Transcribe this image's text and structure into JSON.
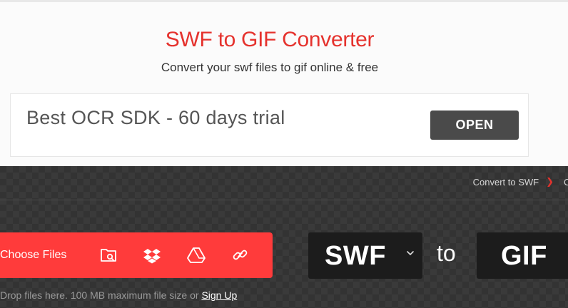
{
  "header": {
    "title": "SWF to GIF Converter",
    "subtitle": "Convert your swf files to gif online & free"
  },
  "ad": {
    "text": "Best OCR SDK - 60 days trial",
    "button_label": "OPEN"
  },
  "breadcrumb": {
    "link": "Convert to SWF",
    "next_partial": "C"
  },
  "upload": {
    "choose_label": "Choose Files",
    "icons": [
      "folder-search-icon",
      "dropbox-icon",
      "google-drive-icon",
      "link-icon"
    ],
    "drop_text": "Drop files here. 100 MB maximum file size or ",
    "signup_label": "Sign Up"
  },
  "converter": {
    "from_format": "SWF",
    "to_word": "to",
    "to_format": "GIF"
  },
  "colors": {
    "accent": "#e5322d",
    "button_red": "#ff3b3b",
    "dark_bg": "#333333",
    "format_box": "#1c1c1c"
  }
}
